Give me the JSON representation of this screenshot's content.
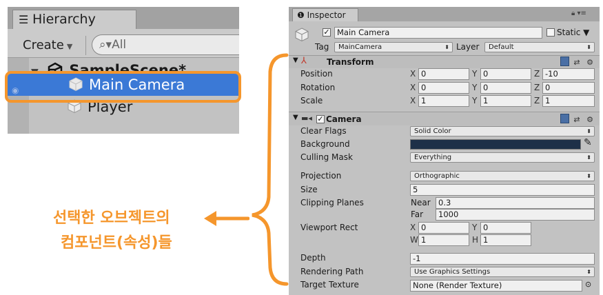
{
  "hierarchy": {
    "tab_label": "Hierarchy",
    "create_label": "Create",
    "search_placeholder": "All",
    "scene_name": "SampleScene*",
    "items": [
      "Main Camera",
      "Player"
    ]
  },
  "annotation": {
    "line1": "선택한 오브젝트의",
    "line2": "컴포넌트(속성)들",
    "color": "#f5962c"
  },
  "inspector": {
    "tab_label": "Inspector",
    "object_name": "Main Camera",
    "static_label": "Static",
    "tag_label": "Tag",
    "tag_value": "MainCamera",
    "layer_label": "Layer",
    "layer_value": "Default",
    "transform": {
      "title": "Transform",
      "rows": [
        {
          "label": "Position",
          "x": "0",
          "y": "0",
          "z": "-10"
        },
        {
          "label": "Rotation",
          "x": "0",
          "y": "0",
          "z": "0"
        },
        {
          "label": "Scale",
          "x": "1",
          "y": "1",
          "z": "1"
        }
      ]
    },
    "camera": {
      "title": "Camera",
      "clear_flags_label": "Clear Flags",
      "clear_flags_value": "Solid Color",
      "background_label": "Background",
      "background_color": "#1e3048",
      "culling_mask_label": "Culling Mask",
      "culling_mask_value": "Everything",
      "projection_label": "Projection",
      "projection_value": "Orthographic",
      "size_label": "Size",
      "size_value": "5",
      "clipping_label": "Clipping Planes",
      "near_label": "Near",
      "near_value": "0.3",
      "far_label": "Far",
      "far_value": "1000",
      "viewport_label": "Viewport Rect",
      "viewport_x": "0",
      "viewport_y": "0",
      "viewport_w": "1",
      "viewport_h": "1",
      "depth_label": "Depth",
      "depth_value": "-1",
      "rendering_path_label": "Rendering Path",
      "rendering_path_value": "Use Graphics Settings",
      "target_texture_label": "Target Texture",
      "target_texture_value": "None (Render Texture)"
    },
    "axis_labels": {
      "x": "X",
      "y": "Y",
      "z": "Z",
      "w": "W",
      "h": "H"
    }
  }
}
